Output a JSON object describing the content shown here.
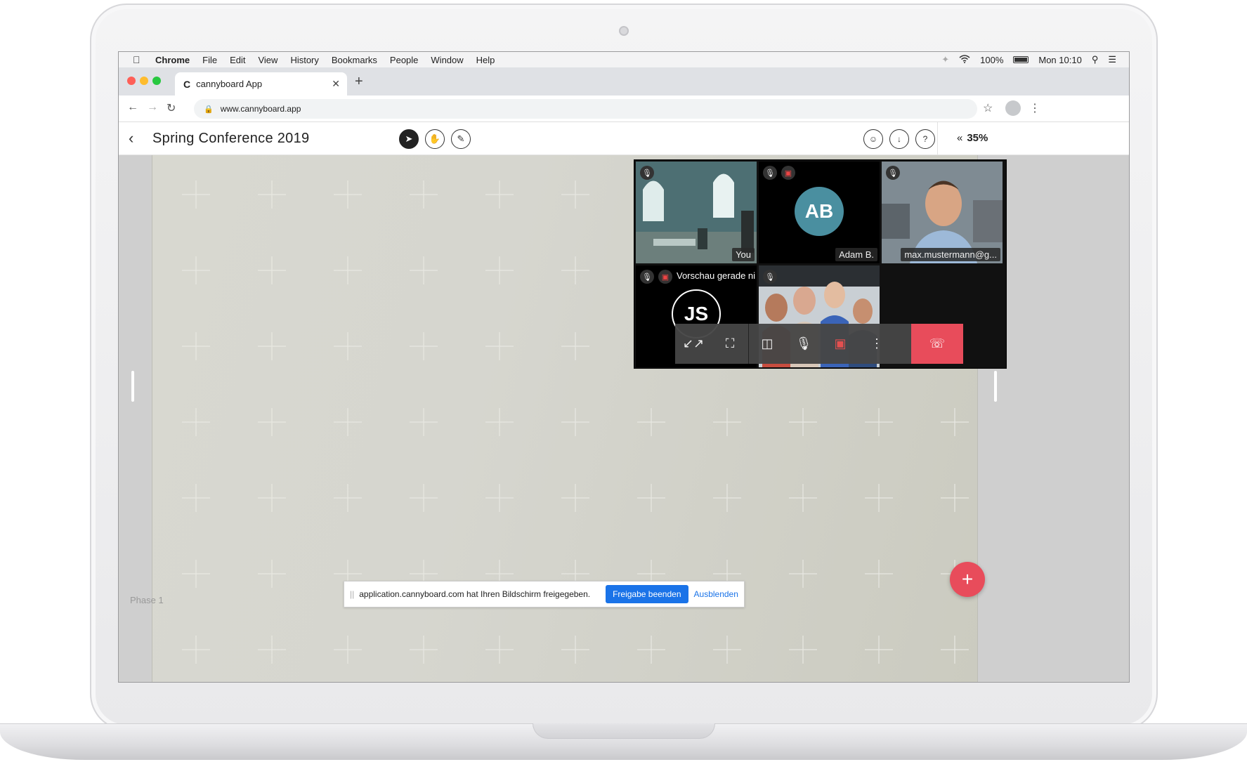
{
  "menubar": {
    "items": [
      "Chrome",
      "File",
      "Edit",
      "View",
      "History",
      "Bookmarks",
      "People",
      "Window",
      "Help"
    ],
    "battery": "100%",
    "clock": "Mon 10:10"
  },
  "browser": {
    "tab_title": "cannyboard App",
    "tab_favicon": "C",
    "url": "www.cannyboard.app"
  },
  "app": {
    "board_title": "Spring Conference 2019",
    "zoom": "35%",
    "phase_label": "Phase 1",
    "help_label": "?"
  },
  "video": {
    "tiles": [
      {
        "name": "You"
      },
      {
        "name": "Adam B.",
        "initials": "AB"
      },
      {
        "name": "max.mustermann@g..."
      },
      {
        "initials": "JS",
        "note": "Vorschau gerade ni"
      },
      {}
    ]
  },
  "share_notice": {
    "message": "application.cannyboard.com hat Ihren Bildschirm freigegeben.",
    "stop_label": "Freigabe beenden",
    "hide_label": "Ausblenden"
  },
  "colors": {
    "accent_red": "#e84c5b",
    "avatar_teal": "#4a8fa0",
    "link_blue": "#1a73e8"
  }
}
